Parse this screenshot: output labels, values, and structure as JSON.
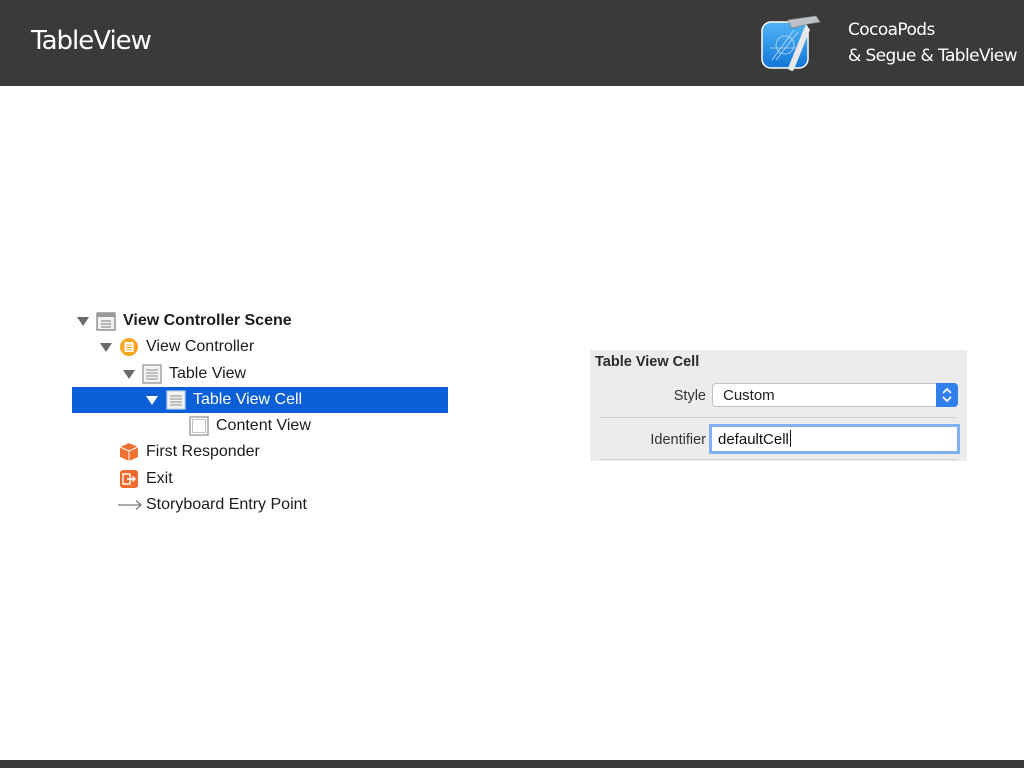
{
  "header": {
    "title": "TableView",
    "subtitle_line1": "CocoaPods",
    "subtitle_line2": "& Segue & TableView",
    "logo_icon": "xcode-icon",
    "background": "#3a3a39"
  },
  "outline": {
    "items": [
      {
        "label": "View Controller Scene",
        "icon": "scene-icon",
        "expanded": true
      },
      {
        "label": "View Controller",
        "icon": "view-controller-icon",
        "expanded": true
      },
      {
        "label": "Table View",
        "icon": "table-view-icon",
        "expanded": true
      },
      {
        "label": "Table View Cell",
        "icon": "table-view-cell-icon",
        "expanded": true,
        "selected": true
      },
      {
        "label": "Content View",
        "icon": "content-view-icon"
      },
      {
        "label": "First Responder",
        "icon": "first-responder-icon"
      },
      {
        "label": "Exit",
        "icon": "exit-icon"
      },
      {
        "label": "Storyboard Entry Point",
        "icon": "arrow-right-icon"
      }
    ],
    "selection_color": "#0a5fd6"
  },
  "inspector": {
    "title": "Table View Cell",
    "style_label": "Style",
    "style_value": "Custom",
    "identifier_label": "Identifier",
    "identifier_value": "defaultCell",
    "accent": "#2f80ed"
  }
}
